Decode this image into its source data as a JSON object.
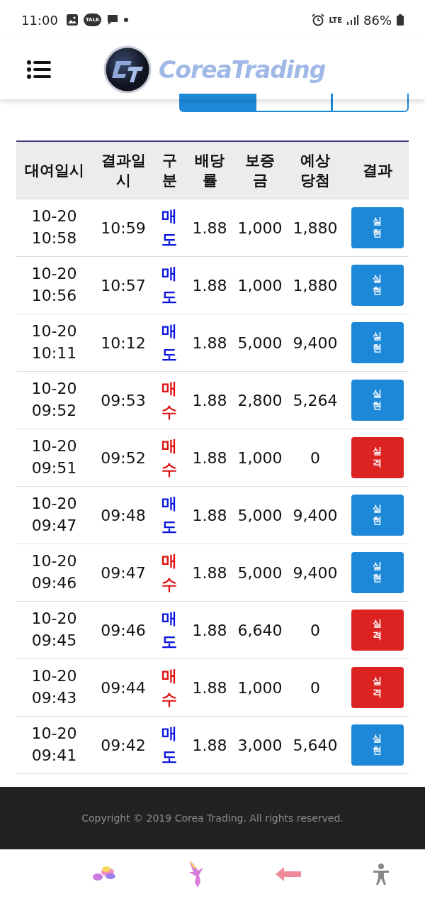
{
  "status_bar": {
    "time": "11:00",
    "talk": "TALK",
    "network": "LTE",
    "battery": "86%"
  },
  "header": {
    "logo": "CoreaTrading"
  },
  "tabs": [
    {
      "selected": true
    },
    {
      "selected": false
    },
    {
      "selected": false
    }
  ],
  "table": {
    "columns": [
      "대여일시",
      "결과일시",
      "구분",
      "배당률",
      "보증금",
      "예상당첨",
      "결과"
    ],
    "rows": [
      {
        "date": "10-20",
        "time": "10:58",
        "result_time": "10:59",
        "type": {
          "text": "매도",
          "kind": "sell"
        },
        "rate": "1.88",
        "deposit": "1,000",
        "expected": "1,880",
        "result": {
          "text": "실현",
          "kind": "win"
        }
      },
      {
        "date": "10-20",
        "time": "10:56",
        "result_time": "10:57",
        "type": {
          "text": "매도",
          "kind": "sell"
        },
        "rate": "1.88",
        "deposit": "1,000",
        "expected": "1,880",
        "result": {
          "text": "실현",
          "kind": "win"
        }
      },
      {
        "date": "10-20",
        "time": "10:11",
        "result_time": "10:12",
        "type": {
          "text": "매도",
          "kind": "sell"
        },
        "rate": "1.88",
        "deposit": "5,000",
        "expected": "9,400",
        "result": {
          "text": "실현",
          "kind": "win"
        }
      },
      {
        "date": "10-20",
        "time": "09:52",
        "result_time": "09:53",
        "type": {
          "text": "매수",
          "kind": "buy"
        },
        "rate": "1.88",
        "deposit": "2,800",
        "expected": "5,264",
        "result": {
          "text": "실현",
          "kind": "win"
        }
      },
      {
        "date": "10-20",
        "time": "09:51",
        "result_time": "09:52",
        "type": {
          "text": "매수",
          "kind": "buy"
        },
        "rate": "1.88",
        "deposit": "1,000",
        "expected": "0",
        "result": {
          "text": "실격",
          "kind": "loss"
        }
      },
      {
        "date": "10-20",
        "time": "09:47",
        "result_time": "09:48",
        "type": {
          "text": "매도",
          "kind": "sell"
        },
        "rate": "1.88",
        "deposit": "5,000",
        "expected": "9,400",
        "result": {
          "text": "실현",
          "kind": "win"
        }
      },
      {
        "date": "10-20",
        "time": "09:46",
        "result_time": "09:47",
        "type": {
          "text": "매수",
          "kind": "buy"
        },
        "rate": "1.88",
        "deposit": "5,000",
        "expected": "9,400",
        "result": {
          "text": "실현",
          "kind": "win"
        }
      },
      {
        "date": "10-20",
        "time": "09:45",
        "result_time": "09:46",
        "type": {
          "text": "매도",
          "kind": "sell"
        },
        "rate": "1.88",
        "deposit": "6,640",
        "expected": "0",
        "result": {
          "text": "실격",
          "kind": "loss"
        }
      },
      {
        "date": "10-20",
        "time": "09:43",
        "result_time": "09:44",
        "type": {
          "text": "매수",
          "kind": "buy"
        },
        "rate": "1.88",
        "deposit": "1,000",
        "expected": "0",
        "result": {
          "text": "실격",
          "kind": "loss"
        }
      },
      {
        "date": "10-20",
        "time": "09:41",
        "result_time": "09:42",
        "type": {
          "text": "매도",
          "kind": "sell"
        },
        "rate": "1.88",
        "deposit": "3,000",
        "expected": "5,640",
        "result": {
          "text": "실현",
          "kind": "win"
        }
      }
    ]
  },
  "footer": {
    "copyright": "Copyright © 2019 Corea Trading. All rights reserved."
  }
}
